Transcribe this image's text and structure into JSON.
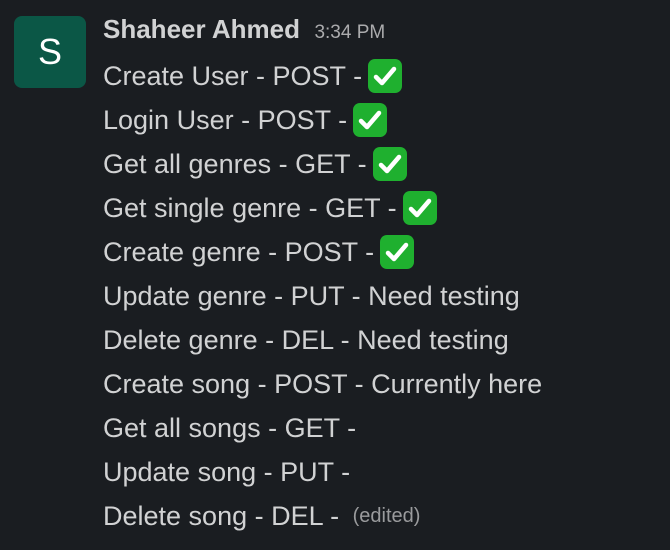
{
  "message": {
    "avatar_letter": "S",
    "sender": "Shaheer Ahmed",
    "timestamp": "3:34 PM",
    "lines": [
      {
        "text": "Create User - POST - ",
        "icon": "white-check-mark"
      },
      {
        "text": "Login User - POST - ",
        "icon": "white-check-mark"
      },
      {
        "text": "Get all genres - GET - ",
        "icon": "white-check-mark"
      },
      {
        "text": "Get single genre - GET - ",
        "icon": "white-check-mark"
      },
      {
        "text": "Create genre - POST - ",
        "icon": "white-check-mark"
      },
      {
        "text": "Update genre - PUT - Need testing"
      },
      {
        "text": "Delete genre - DEL - Need testing"
      },
      {
        "text": "Create song - POST - Currently here"
      },
      {
        "text": "Get all songs - GET -"
      },
      {
        "text": "Update song - PUT -"
      },
      {
        "text": "Delete song - DEL - "
      }
    ],
    "edited_label": "(edited)"
  },
  "colors": {
    "background": "#1a1d21",
    "avatar": "#0b5746",
    "check_emoji": "#1fb02f",
    "text": "#d1d2d3",
    "muted": "#ababad"
  }
}
